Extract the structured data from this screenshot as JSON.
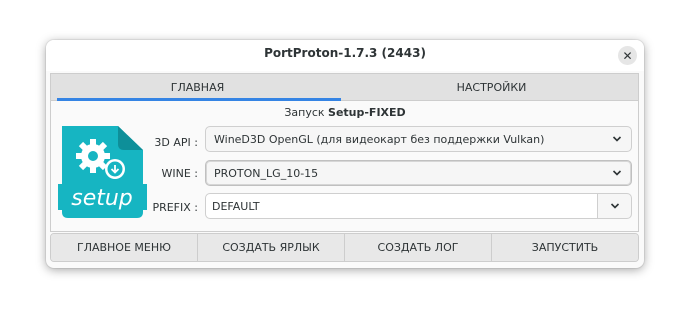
{
  "window": {
    "title": "PortProton-1.7.3 (2443)"
  },
  "tabs": [
    {
      "label": "ГЛАВНАЯ",
      "active": true
    },
    {
      "label": "НАСТРОЙКИ",
      "active": false
    }
  ],
  "main": {
    "run_prefix": "Запуск ",
    "run_name": "Setup-FIXED",
    "logo_text": "setup",
    "fields": {
      "api_label": "3D API :",
      "api_value": "WineD3D OpenGL (для видеокарт без поддержки Vulkan)",
      "wine_label": "WINE :",
      "wine_value": "PROTON_LG_10-15",
      "prefix_label": "PREFIX :",
      "prefix_value": "DEFAULT"
    }
  },
  "bottom_buttons": [
    {
      "label": "ГЛАВНОЕ МЕНЮ"
    },
    {
      "label": "СОЗДАТЬ ЯРЛЫК"
    },
    {
      "label": "СОЗДАТЬ ЛОГ"
    },
    {
      "label": "ЗАПУСТИТЬ"
    }
  ],
  "colors": {
    "accent": "#3584e4",
    "logo_teal": "#16b5c2"
  }
}
